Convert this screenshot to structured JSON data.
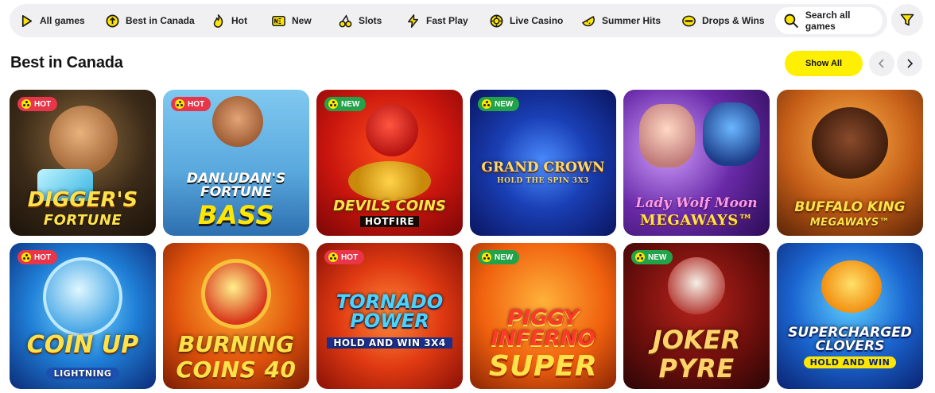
{
  "nav": {
    "items": [
      {
        "label": "All games",
        "icon": "play-icon"
      },
      {
        "label": "Best in Canada",
        "icon": "trophy-icon"
      },
      {
        "label": "Hot",
        "icon": "flame-icon"
      },
      {
        "label": "New",
        "icon": "new-icon"
      },
      {
        "label": "Slots",
        "icon": "cherries-icon"
      },
      {
        "label": "Fast Play",
        "icon": "lightning-icon"
      },
      {
        "label": "Live Casino",
        "icon": "chip-icon"
      },
      {
        "label": "Summer Hits",
        "icon": "watermelon-icon"
      },
      {
        "label": "Drops & Wins",
        "icon": "drops-icon"
      }
    ],
    "search_label": "Search all games"
  },
  "section": {
    "title": "Best in Canada",
    "show_all_label": "Show All"
  },
  "colors": {
    "accent_yellow": "#ffef00",
    "badge_hot": "#e8354a",
    "badge_new": "#22a34a",
    "nav_bg": "#f0f0f3"
  },
  "games": [
    {
      "title": "DIGGER'S",
      "subtitle": "FORTUNE",
      "badge": "HOT"
    },
    {
      "title": "DANLUDAN'S FORTUNE",
      "subtitle": "BASS",
      "badge": "HOT"
    },
    {
      "title": "DEVILS COINS",
      "subtitle": "HOTFIRE",
      "badge": "NEW"
    },
    {
      "title": "GRAND CROWN",
      "subtitle": "HOLD THE SPIN 3X3",
      "badge": "NEW"
    },
    {
      "title": "Lady Wolf Moon",
      "subtitle": "MEGAWAYS™",
      "badge": ""
    },
    {
      "title": "BUFFALO KING",
      "subtitle": "MEGAWAYS™",
      "badge": ""
    },
    {
      "title": "COIN UP",
      "subtitle": "LIGHTNING",
      "badge": "HOT"
    },
    {
      "title": "BURNING",
      "subtitle": "COINS 40",
      "badge": ""
    },
    {
      "title": "TORNADO POWER",
      "subtitle": "HOLD AND WIN 3X4",
      "badge": "HOT"
    },
    {
      "title": "PIGGY INFERNO",
      "subtitle": "SUPER",
      "badge": "NEW"
    },
    {
      "title": "JOKER",
      "subtitle": "PYRE",
      "badge": "NEW"
    },
    {
      "title": "SUPERCHARGED CLOVERS",
      "subtitle": "HOLD AND WIN",
      "badge": ""
    }
  ]
}
